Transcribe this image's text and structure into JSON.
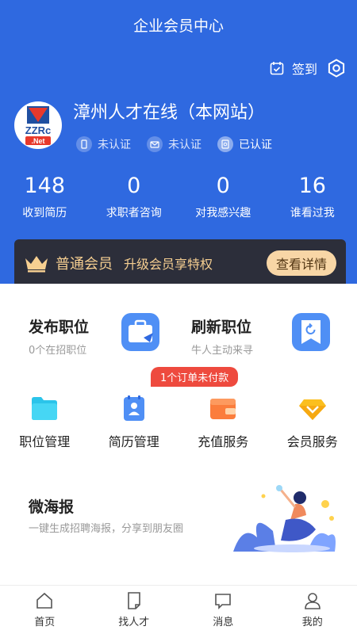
{
  "header": {
    "title": "企业会员中心",
    "signin_label": "签到"
  },
  "company": {
    "name": "漳州人才在线（本网站）",
    "logo_text_top": "ZZRc",
    "logo_text_bottom": ".Net",
    "badges": [
      {
        "icon": "phone-icon",
        "label": "未认证",
        "verified": false
      },
      {
        "icon": "mail-icon",
        "label": "未认证",
        "verified": false
      },
      {
        "icon": "license-icon",
        "label": "已认证",
        "verified": true
      }
    ]
  },
  "stats": [
    {
      "value": "148",
      "label": "收到简历"
    },
    {
      "value": "0",
      "label": "求职者咨询"
    },
    {
      "value": "0",
      "label": "对我感兴趣"
    },
    {
      "value": "16",
      "label": "谁看过我"
    }
  ],
  "vip": {
    "level": "普通会员",
    "pitch": "升级会员享特权",
    "button": "查看详情"
  },
  "features": [
    {
      "title": "发布职位",
      "subtitle": "0个在招职位",
      "icon": "briefcase-icon"
    },
    {
      "title": "刷新职位",
      "subtitle": "牛人主动来寻",
      "icon": "refresh-icon"
    }
  ],
  "unpaid_notice": "1个订单未付款",
  "services": [
    {
      "label": "职位管理",
      "icon": "folder-icon"
    },
    {
      "label": "简历管理",
      "icon": "resume-icon"
    },
    {
      "label": "充值服务",
      "icon": "wallet-icon"
    },
    {
      "label": "会员服务",
      "icon": "diamond-icon"
    }
  ],
  "poster": {
    "title": "微海报",
    "subtitle": "一键生成招聘海报，分享到朋友圈"
  },
  "tabs": [
    {
      "label": "首页",
      "icon": "home-icon"
    },
    {
      "label": "找人才",
      "icon": "find-talent-icon"
    },
    {
      "label": "消息",
      "icon": "message-icon"
    },
    {
      "label": "我的",
      "icon": "profile-icon"
    }
  ],
  "colors": {
    "brand_blue": "#2f69e0",
    "vip_gold": "#f6cf91",
    "alert_red": "#ee4a3e"
  }
}
